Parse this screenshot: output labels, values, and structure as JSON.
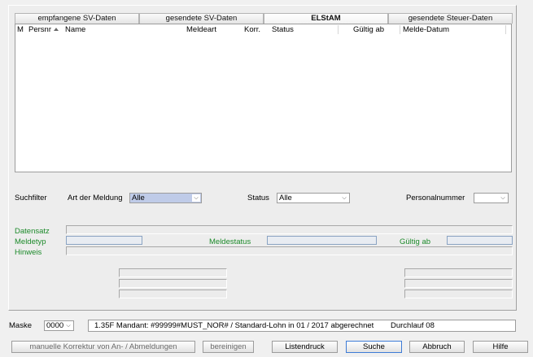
{
  "tabs": [
    {
      "label": "empfangene SV-Daten",
      "active": false
    },
    {
      "label": "gesendete SV-Daten",
      "active": false
    },
    {
      "label": "ELStAM",
      "active": true
    },
    {
      "label": "gesendete Steuer-Daten",
      "active": false
    }
  ],
  "list": {
    "columns": [
      "M",
      "Persnr",
      "Name",
      "Meldeart",
      "Korr.",
      "Status",
      "Gültig ab",
      "Melde-Datum"
    ]
  },
  "filter": {
    "suchfilter_label": "Suchfilter",
    "art_label": "Art der Meldung",
    "art_value": "Alle",
    "status_label": "Status",
    "status_value": "Alle",
    "personal_label": "Personalnummer",
    "personal_value": ""
  },
  "details": {
    "datensatz": "Datensatz",
    "meldetyp": "Meldetyp",
    "meldestatus": "Meldestatus",
    "gueltig_ab": "Gültig ab",
    "hinweis": "Hinweis"
  },
  "footer": {
    "maske_label": "Maske",
    "maske_value": "0000",
    "status_text": "1.35F Mandant: #99999#MUST_NOR# / Standard-Lohn in 01 / 2017 abgerechnet",
    "durchlauf": "Durchlauf 08"
  },
  "buttons": {
    "korrektur": "manuelle Korrektur von An- / Abmeldungen",
    "bereinigen": "bereinigen",
    "listendruck": "Listendruck",
    "suche": "Suche",
    "abbruch": "Abbruch",
    "hilfe": "Hilfe"
  },
  "colors": {
    "label_green": "#1c8a2a",
    "selection_blue": "#bfcbe8",
    "focus_blue": "#3d7bd6"
  }
}
